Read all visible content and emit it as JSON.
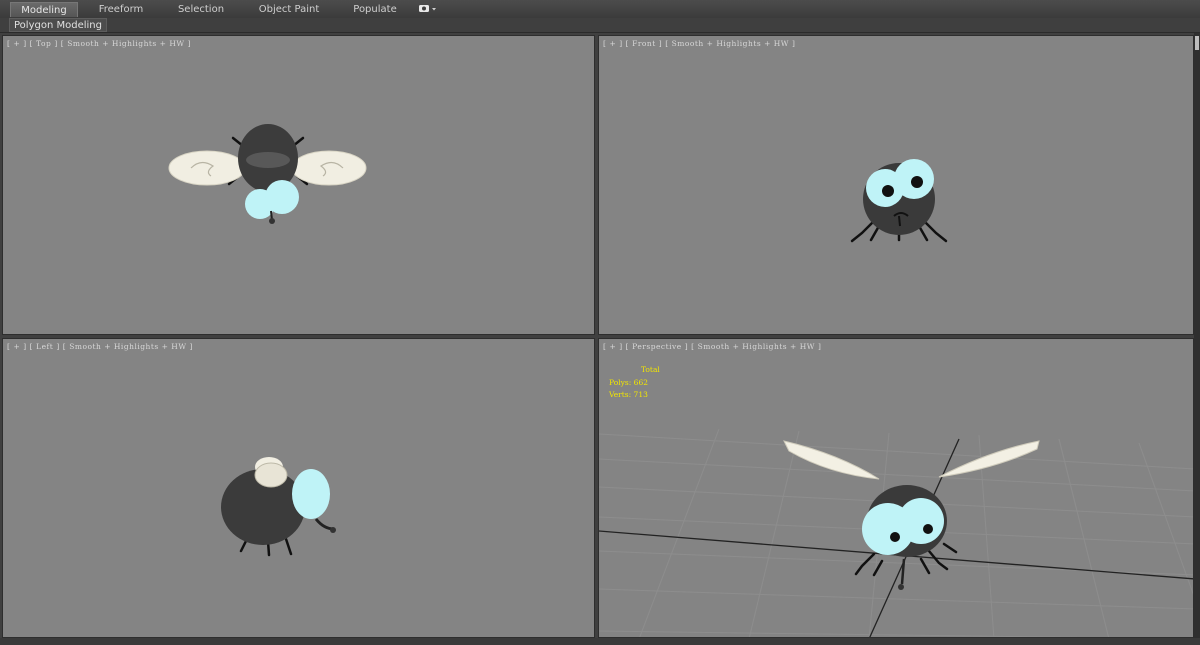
{
  "ribbon": {
    "tabs": [
      {
        "label": "Modeling",
        "active": true
      },
      {
        "label": "Freeform",
        "active": false
      },
      {
        "label": "Selection",
        "active": false
      },
      {
        "label": "Object Paint",
        "active": false
      },
      {
        "label": "Populate",
        "active": false
      }
    ],
    "dropdown_icon": "camera-dropdown-icon"
  },
  "subbar": {
    "label": "Polygon Modeling"
  },
  "viewports": {
    "top": {
      "label": [
        "[",
        "+",
        "]",
        "[",
        "Top",
        "]",
        "[",
        "Smooth + Highlights + HW",
        "]"
      ]
    },
    "front": {
      "label": [
        "[",
        "+",
        "]",
        "[",
        "Front",
        "]",
        "[",
        "Smooth + Highlights + HW",
        "]"
      ]
    },
    "left": {
      "label": [
        "[",
        "+",
        "]",
        "[",
        "Left",
        "]",
        "[",
        "Smooth + Highlights + HW",
        "]"
      ]
    },
    "perspective": {
      "label": [
        "[",
        "+",
        "]",
        "[",
        "Perspective",
        "]",
        "[",
        "Smooth + Highlights + HW",
        "]"
      ],
      "stats": {
        "header": "Total",
        "polys_label": "Polys:",
        "polys_value": "662",
        "verts_label": "Verts:",
        "verts_value": "713"
      }
    }
  },
  "colors": {
    "viewport_bg": "#848484",
    "stats_text": "#f2e600",
    "eye": "#bff3f7",
    "wing": "#f3f0e4",
    "body": "#3a3a3a"
  }
}
